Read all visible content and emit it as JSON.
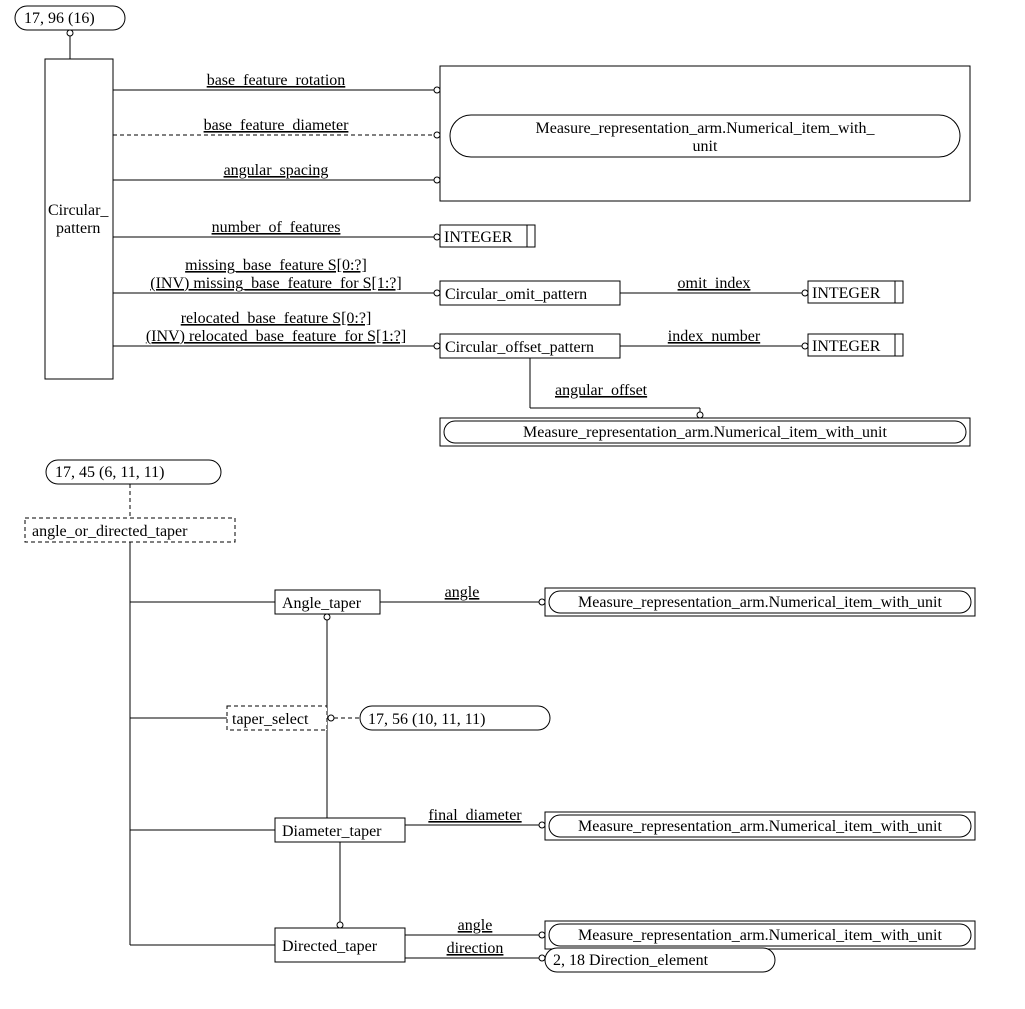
{
  "top_ref": "17, 96 (16)",
  "circular_pattern": {
    "name": "Circular_ pattern",
    "rel1": "base_feature_rotation",
    "rel2": "base_feature_diameter",
    "rel3": "angular_spacing",
    "rel4": "number_of_features",
    "rel5a": "missing_base_feature S[0:?]",
    "rel5b": "(INV) missing_base_feature_for S[1:?]",
    "rel6a": "relocated_base_feature S[0:?]",
    "rel6b": "(INV) relocated_base_feature_for S[1:?]"
  },
  "numerical_item": "Measure_representation_arm.Numerical_item_with_ unit",
  "numerical_item_one": "Measure_representation_arm.Numerical_item_with_unit",
  "integer": "INTEGER",
  "circular_omit": "Circular_omit_pattern",
  "omit_index": "omit_index",
  "circular_offset": "Circular_offset_pattern",
  "index_number": "index_number",
  "angular_offset": "angular_offset",
  "ref2": "17, 45 (6, 11, 11)",
  "angle_or_directed_taper": "angle_or_directed_taper",
  "angle_taper": "Angle_taper",
  "angle": "angle",
  "taper_select": "taper_select",
  "ref3": "17, 56 (10, 11, 11)",
  "diameter_taper": "Diameter_taper",
  "final_diameter": "final_diameter",
  "directed_taper": "Directed_taper",
  "direction": "direction",
  "direction_element": "2, 18 Direction_element"
}
